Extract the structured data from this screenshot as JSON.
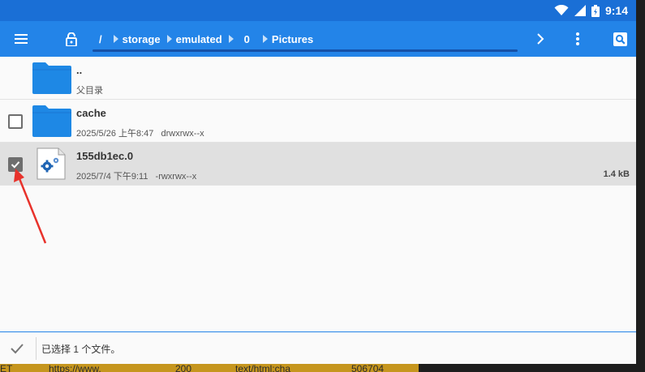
{
  "status": {
    "time": "9:14"
  },
  "appbar": {
    "root_label": "/",
    "breadcrumbs": [
      "storage",
      "emulated",
      "0",
      "Pictures"
    ]
  },
  "files": [
    {
      "name": "..",
      "meta": "父目录"
    },
    {
      "name": "cache",
      "date": "2025/5/26 上午8:47",
      "perms": "drwxrwx--x"
    },
    {
      "name": "155db1ec.0",
      "date": "2025/7/4 下午9:11",
      "perms": "-rwxrwx--x",
      "size": "1.4 kB"
    }
  ],
  "selection": {
    "text": "已选择 1 个文件。"
  },
  "background_strip": {
    "cells": [
      "ET",
      "https://www.",
      "200",
      "text/html;cha",
      "506704"
    ]
  },
  "colors": {
    "appbar": "#2384e8",
    "statusbar": "#1a6fd6",
    "folder": "#1e88e5",
    "selected_row": "#e0e0e0",
    "annotation_arrow": "#e8322b"
  }
}
